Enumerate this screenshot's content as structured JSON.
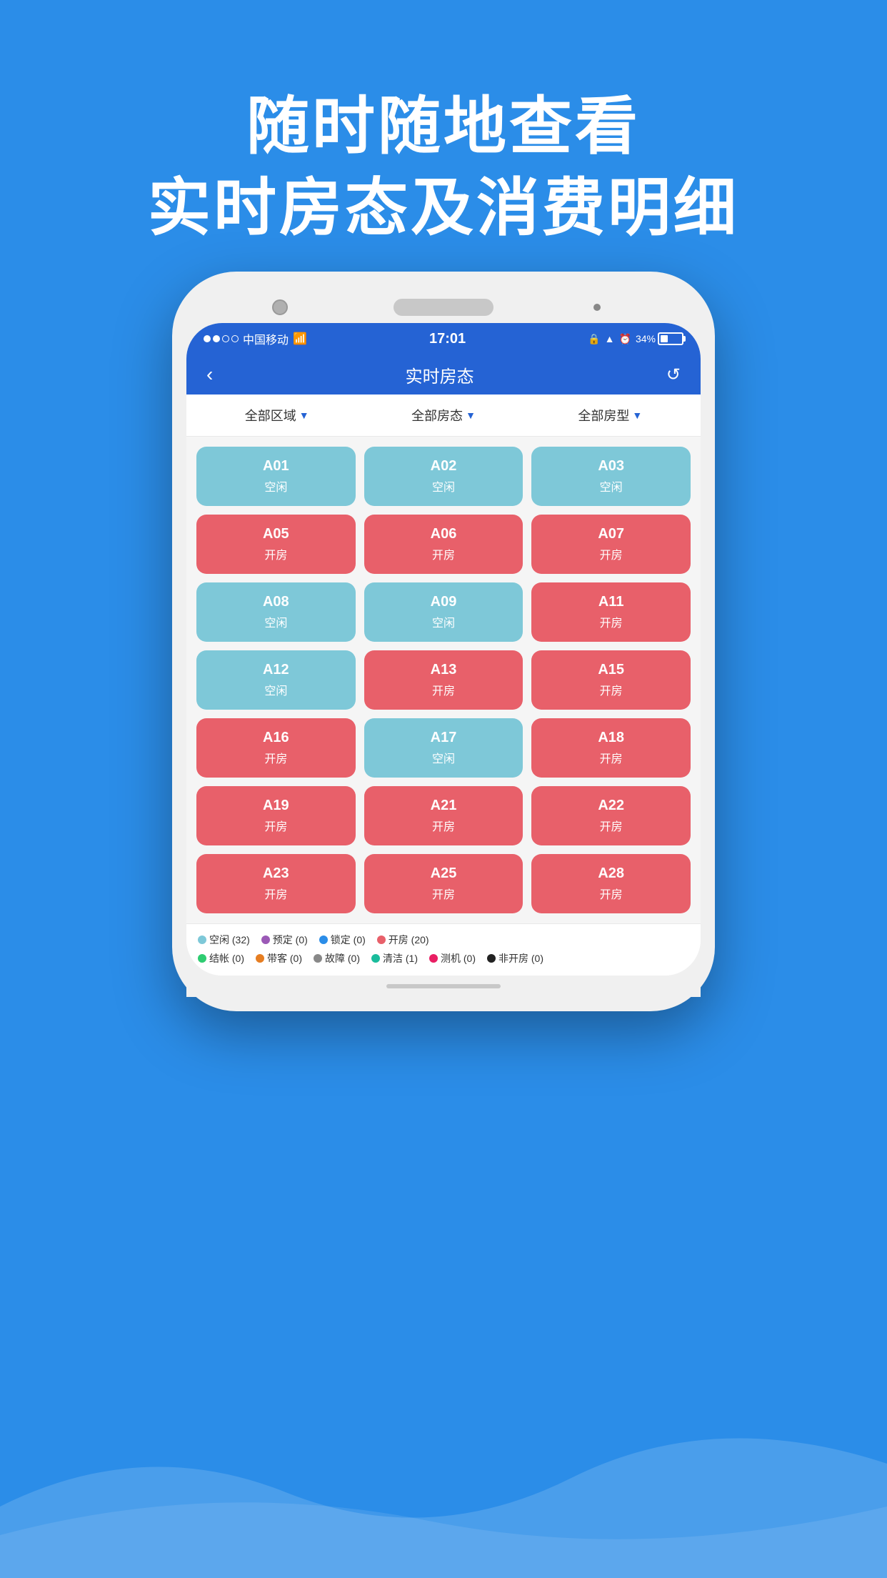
{
  "hero": {
    "line1": "随时随地查看",
    "line2": "实时房态及消费明细"
  },
  "statusBar": {
    "carrier": "中国移动",
    "time": "17:01",
    "battery": "34%"
  },
  "navBar": {
    "title": "实时房态",
    "back": "‹",
    "refresh": "↺"
  },
  "filters": [
    {
      "label": "全部区域",
      "arrow": "▼"
    },
    {
      "label": "全部房态",
      "arrow": "▼"
    },
    {
      "label": "全部房型",
      "arrow": "▼"
    }
  ],
  "rooms": [
    {
      "number": "A01",
      "status": "空闲",
      "type": "vacant"
    },
    {
      "number": "A02",
      "status": "空闲",
      "type": "vacant"
    },
    {
      "number": "A03",
      "status": "空闲",
      "type": "vacant"
    },
    {
      "number": "A05",
      "status": "开房",
      "type": "occupied"
    },
    {
      "number": "A06",
      "status": "开房",
      "type": "occupied"
    },
    {
      "number": "A07",
      "status": "开房",
      "type": "occupied"
    },
    {
      "number": "A08",
      "status": "空闲",
      "type": "vacant"
    },
    {
      "number": "A09",
      "status": "空闲",
      "type": "vacant"
    },
    {
      "number": "A11",
      "status": "开房",
      "type": "occupied"
    },
    {
      "number": "A12",
      "status": "空闲",
      "type": "vacant"
    },
    {
      "number": "A13",
      "status": "开房",
      "type": "occupied"
    },
    {
      "number": "A15",
      "status": "开房",
      "type": "occupied"
    },
    {
      "number": "A16",
      "status": "开房",
      "type": "occupied"
    },
    {
      "number": "A17",
      "status": "空闲",
      "type": "vacant"
    },
    {
      "number": "A18",
      "status": "开房",
      "type": "occupied"
    },
    {
      "number": "A19",
      "status": "开房",
      "type": "occupied"
    },
    {
      "number": "A21",
      "status": "开房",
      "type": "occupied"
    },
    {
      "number": "A22",
      "status": "开房",
      "type": "occupied"
    },
    {
      "number": "A23",
      "status": "开房",
      "type": "occupied"
    },
    {
      "number": "A25",
      "status": "开房",
      "type": "occupied"
    },
    {
      "number": "A28",
      "status": "开房",
      "type": "occupied"
    }
  ],
  "legend": [
    {
      "color": "#7ec8d8",
      "label": "空闲 (32)"
    },
    {
      "color": "#9b59b6",
      "label": "预定 (0)"
    },
    {
      "color": "#2b8de8",
      "label": "锁定 (0)"
    },
    {
      "color": "#e8606a",
      "label": "开房 (20)"
    },
    {
      "color": "#2ecc71",
      "label": "结帐 (0)"
    },
    {
      "color": "#e67e22",
      "label": "带客 (0)"
    },
    {
      "color": "#888888",
      "label": "故障 (0)"
    },
    {
      "color": "#1abc9c",
      "label": "清洁 (1)"
    },
    {
      "color": "#e91e63",
      "label": "测机 (0)"
    },
    {
      "color": "#222222",
      "label": "非开房 (0)"
    }
  ]
}
